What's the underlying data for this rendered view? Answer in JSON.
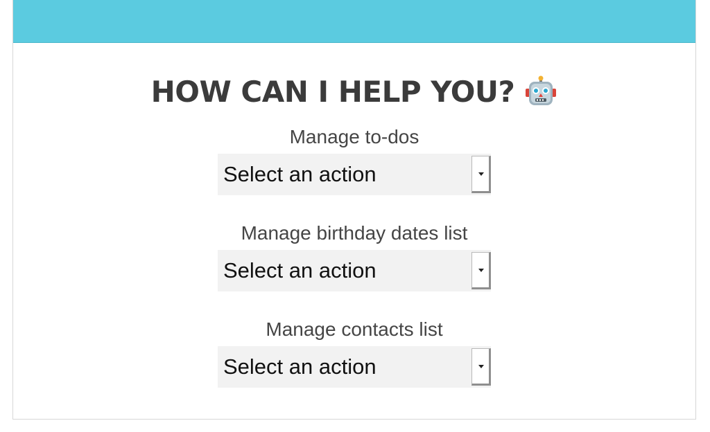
{
  "header": {
    "title": "HOW CAN I HELP YOU?",
    "title_icon": "robot-emoji-icon",
    "bar_color": "#5bcbe0"
  },
  "sections": [
    {
      "label": "Manage to-dos",
      "select_value": "Select an action"
    },
    {
      "label": "Manage birthday dates list",
      "select_value": "Select an action"
    },
    {
      "label": "Manage contacts list",
      "select_value": "Select an action"
    }
  ]
}
